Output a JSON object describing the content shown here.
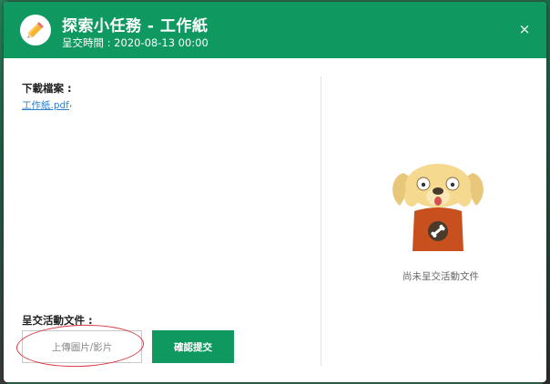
{
  "header": {
    "title": "探索小任務 - 工作紙",
    "subtitle": "呈交時間 : 2020-08-13 00:00",
    "close_label": "×"
  },
  "download": {
    "label": "下載檔案 :",
    "files": [
      {
        "name": "工作紙.pdf"
      }
    ],
    "separator": ","
  },
  "submission": {
    "label": "呈交活動文件 :",
    "upload_label": "上傳圖片/影片",
    "confirm_label": "確認提交",
    "empty_state": "尚未呈交活動文件"
  },
  "colors": {
    "brand_green": "#0f9960",
    "link_blue": "#2f80c9",
    "annotation_red": "#d9363e"
  },
  "icons": {
    "header": "pencil-icon",
    "close": "close-icon",
    "empty_state": "scared-dog-mascot"
  }
}
